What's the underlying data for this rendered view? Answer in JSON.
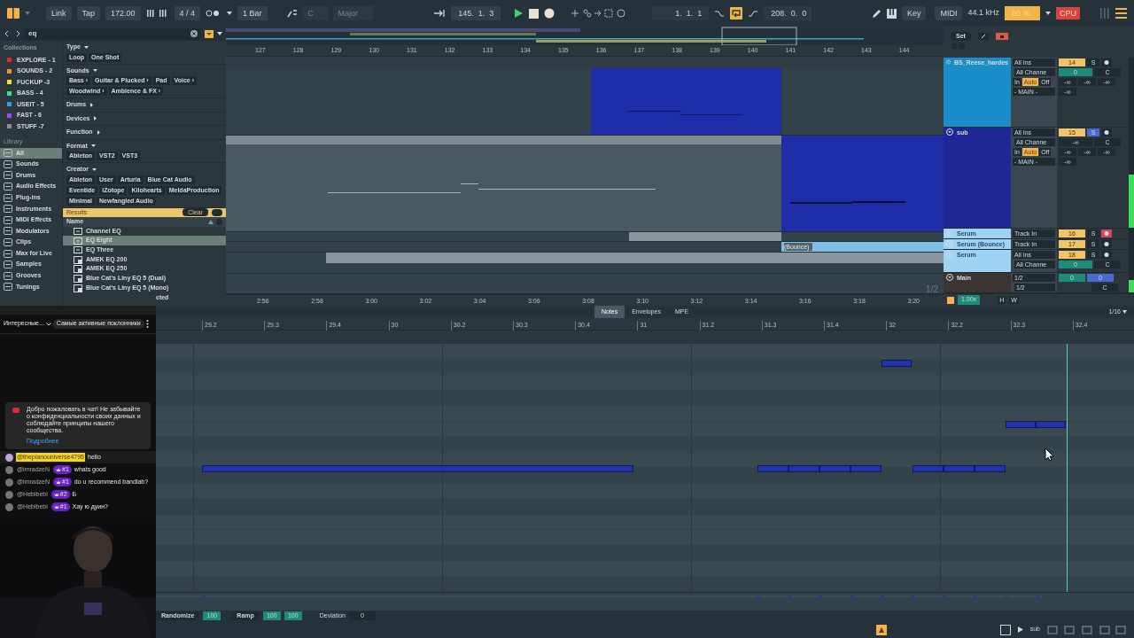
{
  "control_bar": {
    "link": "Link",
    "tap": "Tap",
    "tempo": "172.00",
    "signature": "4 / 4",
    "quantize": "1 Bar",
    "key": "C",
    "scale": "Major",
    "position": "145.  1.  3",
    "loop_start": "1.  1.  1",
    "loop_on": true,
    "loop_length": "208.  0.  0",
    "key_button": "Key",
    "midi_button": "MIDI",
    "sample_rate": "44.1 kHz",
    "cpu_load": "80 %",
    "cpu": "CPU"
  },
  "browser": {
    "search": "eq",
    "collections_title": "Collections",
    "collections": [
      {
        "label": "EXPLORE - 1",
        "color": "#e0282e"
      },
      {
        "label": "SOUNDS - 2",
        "color": "#e8962c"
      },
      {
        "label": "FUCKUP -3",
        "color": "#e6e52e"
      },
      {
        "label": "BASS - 4",
        "color": "#3ee08e"
      },
      {
        "label": "USEIT - 5",
        "color": "#2e9de8"
      },
      {
        "label": "FAST - 6",
        "color": "#9a4de8"
      },
      {
        "label": "STUFF -7",
        "color": "#8a8f93"
      }
    ],
    "library_title": "Library",
    "library": [
      {
        "label": "All",
        "selected": true
      },
      {
        "label": "Sounds",
        "selected": false
      },
      {
        "label": "Drums",
        "selected": false
      },
      {
        "label": "Audio Effects",
        "selected": false
      },
      {
        "label": "Plug-ins",
        "selected": false
      },
      {
        "label": "Instruments",
        "selected": false
      },
      {
        "label": "MIDI Effects",
        "selected": false
      },
      {
        "label": "Modulators",
        "selected": false
      },
      {
        "label": "Clips",
        "selected": false
      },
      {
        "label": "Max for Live",
        "selected": false
      },
      {
        "label": "Samples",
        "selected": false
      },
      {
        "label": "Grooves",
        "selected": false
      },
      {
        "label": "Tunings",
        "selected": false
      }
    ],
    "filters": [
      {
        "title": "Type",
        "expanded": true,
        "tags": [
          "Loop",
          "One Shot"
        ]
      },
      {
        "title": "Sounds",
        "expanded": true,
        "tags": [
          "Bass ›",
          "Guitar & Plucked ›",
          "Pad",
          "Voice ›",
          "Woodwind ›",
          "Ambience & FX ›"
        ]
      },
      {
        "title": "Drums",
        "expanded": false
      },
      {
        "title": "Devices",
        "expanded": false
      },
      {
        "title": "Function",
        "expanded": false
      },
      {
        "title": "Format",
        "expanded": true,
        "tags": [
          "Ableton",
          "VST2",
          "VST3"
        ]
      },
      {
        "title": "Creator",
        "expanded": true,
        "tags": [
          "Ableton",
          "User",
          "Arturia",
          "Blue Cat Audio",
          "Eventide",
          "iZotope",
          "Kilohearts",
          "MeldaProduction",
          "Minimal",
          "Newfangled Audio"
        ]
      }
    ],
    "results_title": "Results",
    "clear": "Clear",
    "name_column": "Name",
    "results": [
      {
        "label": "Channel EQ",
        "kind": "native",
        "selected": false
      },
      {
        "label": "EQ Eight",
        "kind": "native",
        "selected": true
      },
      {
        "label": "EQ Three",
        "kind": "native",
        "selected": false
      },
      {
        "label": "AMEK EQ 200",
        "kind": "plugin",
        "selected": false
      },
      {
        "label": "AMEK EQ 250",
        "kind": "plugin",
        "selected": false
      },
      {
        "label": "Blue Cat's Liny EQ 5 (Dual)",
        "kind": "plugin",
        "selected": false
      },
      {
        "label": "Blue Cat's Liny EQ 5 (Mono)",
        "kind": "plugin",
        "selected": false
      }
    ],
    "footer": "cted"
  },
  "arrangement": {
    "bars": [
      "127",
      "128",
      "129",
      "130",
      "131",
      "132",
      "133",
      "134",
      "135",
      "136",
      "137",
      "138",
      "139",
      "140",
      "141",
      "142",
      "143",
      "144"
    ],
    "times": [
      "2:56",
      "2:58",
      "3:00",
      "3:02",
      "3:04",
      "3:06",
      "3:08",
      "3:10",
      "3:12",
      "3:14",
      "3:16",
      "3:18",
      "3:20"
    ],
    "zoom_hint": "1/2",
    "set": "Set",
    "speed": "1.00x",
    "h": "H",
    "w": "W"
  },
  "tracks": [
    {
      "name": "BS_Reese_hardes",
      "color": "#1b8ec9",
      "input": "All Ins",
      "channel": "All Channe",
      "monitor": [
        "In",
        "Auto",
        "Off"
      ],
      "output": "- MAIN -",
      "number": "14",
      "volume": "0",
      "pan": "C",
      "sends": [
        "-∞",
        "-∞",
        "-∞",
        "-∞"
      ],
      "solo_label": "S",
      "solo": false,
      "armed": false
    },
    {
      "name": "sub",
      "color": "#1d2796",
      "input": "All Ins",
      "channel": "All Channe",
      "monitor": [
        "In",
        "Auto",
        "Off"
      ],
      "output": "- MAIN -",
      "number": "15",
      "volume": "-∞",
      "pan": "C",
      "sends": [
        "-∞",
        "-∞",
        "-∞",
        "-∞"
      ],
      "solo_label": "S",
      "solo": true,
      "armed": false
    },
    {
      "name": "Serum",
      "color": "#9fd3f5",
      "input": "Track In",
      "number": "16",
      "solo_label": "S",
      "solo": false,
      "armed": true
    },
    {
      "name": "Serum (Bounce)",
      "color": "#9fd3f5",
      "input": "Track In",
      "number": "17",
      "clip_label": "(Bounce)",
      "solo_label": "S",
      "solo": false,
      "armed": false
    },
    {
      "name": "Serum",
      "color": "#9fd3f5",
      "input": "All Ins",
      "channel": "All Channe",
      "number": "18",
      "volume": "0",
      "pan": "C",
      "solo_label": "S",
      "solo": false,
      "armed": false
    },
    {
      "name": "Main",
      "color": "#3b3431",
      "input": "1/2",
      "channel": "1/2",
      "volume": "0",
      "volume2": "0",
      "pan": "C"
    }
  ],
  "clip_editor": {
    "tabs": [
      {
        "label": "Notes",
        "selected": true
      },
      {
        "label": "Envelopes",
        "selected": false
      },
      {
        "label": "MPE",
        "selected": false
      }
    ],
    "grid": "1/16",
    "beats": [
      "29.2",
      "29.3",
      "29.4",
      "30",
      "30.2",
      "30.3",
      "30.4",
      "31",
      "31.2",
      "31.3",
      "31.4",
      "32",
      "32.2",
      "32.3",
      "32.4"
    ],
    "randomize": "Randomize",
    "randomize_value": "100",
    "ramp": "Ramp",
    "ramp_from": "100",
    "ramp_to": "100",
    "deviation": "Deviation",
    "deviation_value": "0",
    "track": "sub"
  },
  "chat": {
    "filter": "Интересные...",
    "top_fans": "Самые активные поклонники",
    "welcome": "Добро пожаловать в чат! Не забывайте о конфиденциальности своих данных и соблюдайте принципы нашего сообщества.",
    "more": "Подробнее",
    "messages": [
      {
        "author": "@thepianouniverse4795",
        "owner": true,
        "text": "hello"
      },
      {
        "author": "@imradzeN",
        "badge": "#1",
        "owner": false,
        "text": "whats good"
      },
      {
        "author": "@imradzeN",
        "badge": "#1",
        "owner": false,
        "text": "do u recommend bandlab?"
      },
      {
        "author": "@Hebibebi",
        "badge": "#2",
        "owner": false,
        "text": "Б"
      },
      {
        "author": "@Hebibebi",
        "badge": "#1",
        "owner": false,
        "text": "Хау ю дуин?"
      }
    ]
  }
}
